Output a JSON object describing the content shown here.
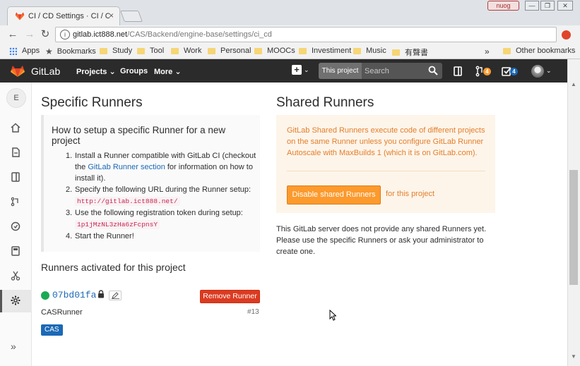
{
  "browser": {
    "tab_title": "CI / CD Settings · CI / CD",
    "tab_close": "×",
    "user_label": "nuog",
    "window_buttons": [
      "—",
      "❐",
      "✕"
    ],
    "url_host": "gitlab.ict888.net",
    "url_path": "/CAS/Backend/engine-base/settings/ci_cd",
    "bookmarks": [
      "Apps",
      "Bookmarks",
      "Study",
      "Tool",
      "Work",
      "Personal",
      "MOOCs",
      "Investiment",
      "Music",
      "有聲書"
    ],
    "bookmarks_overflow": "»",
    "other_bookmarks": "Other bookmarks"
  },
  "header": {
    "brand": "GitLab",
    "nav": [
      "Projects",
      "Groups",
      "More"
    ],
    "search_scope": "This project",
    "search_placeholder": "Search",
    "merge_requests_count": "4",
    "todos_count": "4"
  },
  "sidebar": {
    "project_initial": "E",
    "items": [
      "home-icon",
      "repository-icon",
      "issues-icon",
      "merge-request-icon",
      "ci-cd-icon",
      "wiki-icon",
      "snippets-icon",
      "settings-icon"
    ],
    "collapse": "»"
  },
  "specific": {
    "heading": "Specific Runners",
    "setup_title": "How to setup a specific Runner for a new project",
    "steps": {
      "s1_num": "1.",
      "s1_a": "Install a Runner compatible with GitLab CI (checkout the ",
      "s1_link": "GitLab Runner section",
      "s1_b": " for information on how to install it).",
      "s2_num": "2.",
      "s2_text": "Specify the following URL during the Runner setup: ",
      "s2_code": "http://gitlab.ict888.net/",
      "s3_num": "3.",
      "s3_text": "Use the following registration token during setup: ",
      "s3_code": "1p1jMzNL3zHa6zFcpnsY",
      "s4_num": "4.",
      "s4_text": "Start the Runner!"
    },
    "activated_heading": "Runners activated for this project",
    "runner": {
      "id": "07bd01fa",
      "remove_label": "Remove Runner",
      "description": "CASRunner",
      "number": "#13",
      "tag": "CAS"
    }
  },
  "shared": {
    "heading": "Shared Runners",
    "notice": "GitLab Shared Runners execute code of different projects on the same Runner unless you configure GitLab Runner Autoscale with MaxBuilds 1 (which it is on GitLab.com).",
    "disable_label": "Disable shared Runners",
    "for_project": "for this project",
    "none_text": "This GitLab server does not provide any shared Runners yet. Please use the specific Runners or ask your administrator to create one."
  },
  "colors": {
    "header_bg": "#2b2b2b",
    "link": "#1b69b6",
    "success": "#1aaa55",
    "danger": "#db3b21",
    "warning": "#fc9a2d"
  }
}
